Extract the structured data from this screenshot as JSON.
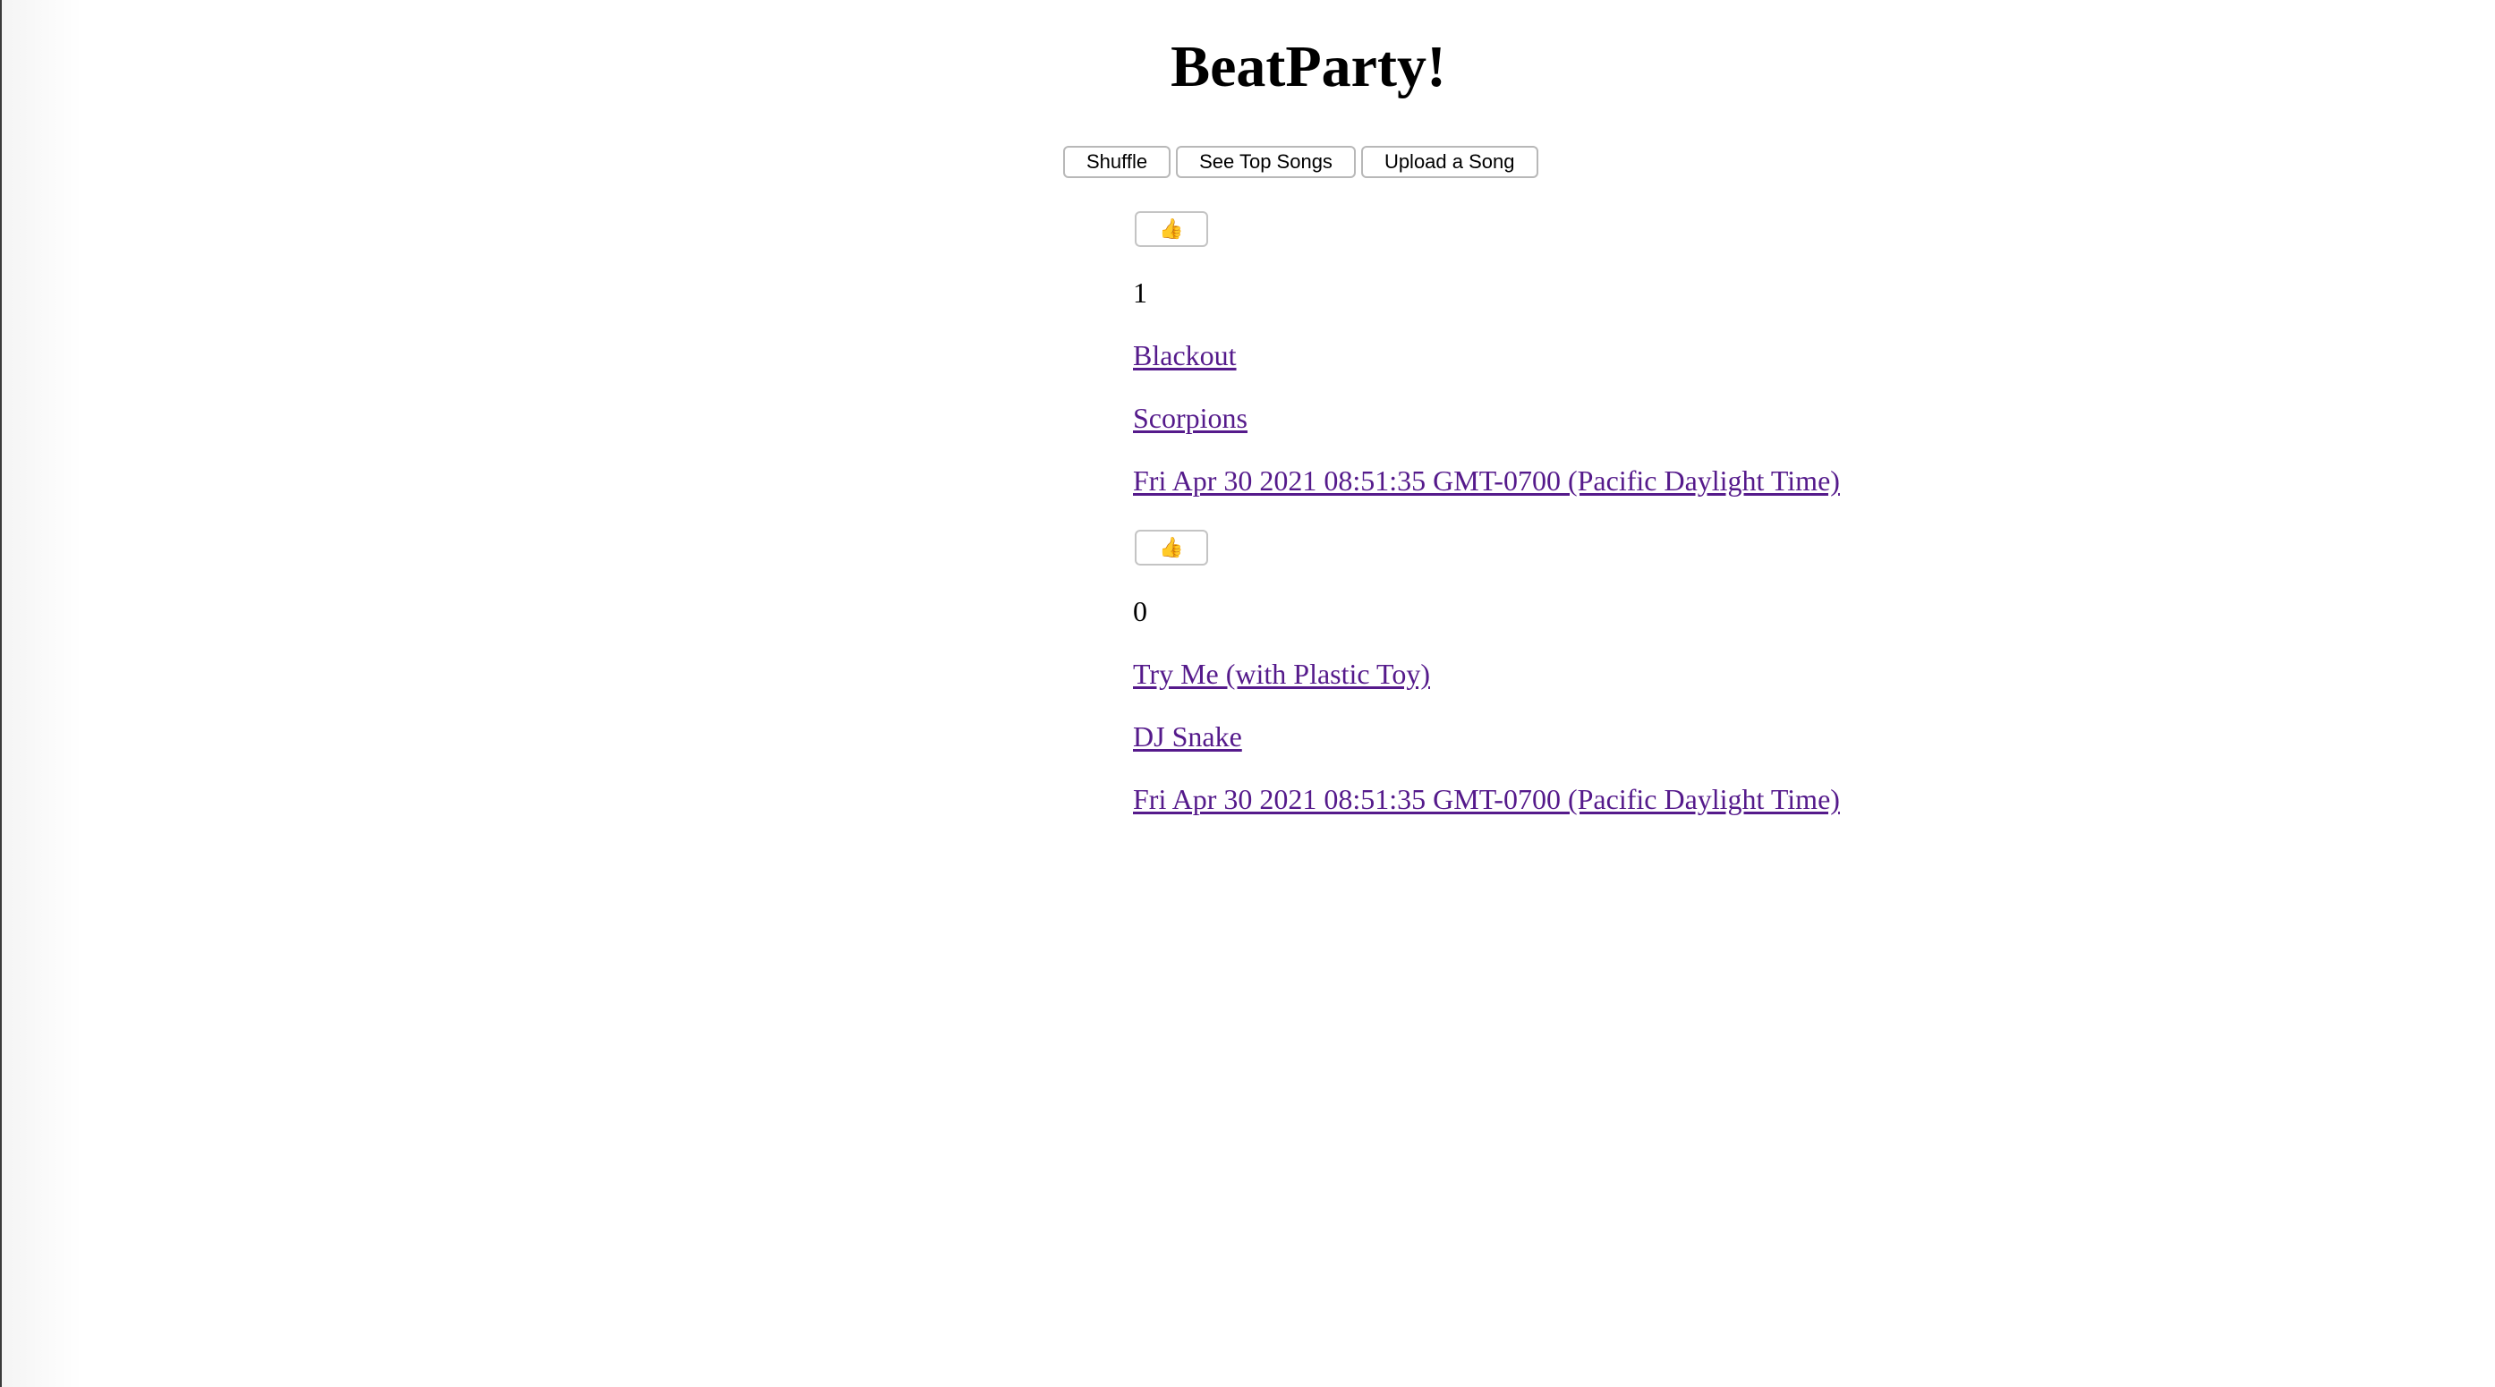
{
  "page": {
    "title": "BeatParty!"
  },
  "toolbar": {
    "shuffle_label": "Shuffle",
    "top_songs_label": "See Top Songs",
    "upload_label": "Upload a Song"
  },
  "songs": [
    {
      "vote_icon": "thumbs-up-icon",
      "vote_glyph": "👍",
      "voted": true,
      "votes": "1",
      "title": "Blackout",
      "artist": "Scorpions",
      "date": "Fri Apr 30 2021 08:51:35 GMT-0700 (Pacific Daylight Time)"
    },
    {
      "vote_icon": "thumbs-up-icon",
      "vote_glyph": "👍",
      "voted": false,
      "votes": "0",
      "title": "Try Me (with Plastic Toy)",
      "artist": "DJ Snake",
      "date": "Fri Apr 30 2021 08:51:35 GMT-0700 (Pacific Daylight Time)"
    }
  ],
  "colors": {
    "link_visited": "#551a8b",
    "thumb_active": "#e7a51c",
    "thumb_inactive": "#a9a9a9"
  }
}
